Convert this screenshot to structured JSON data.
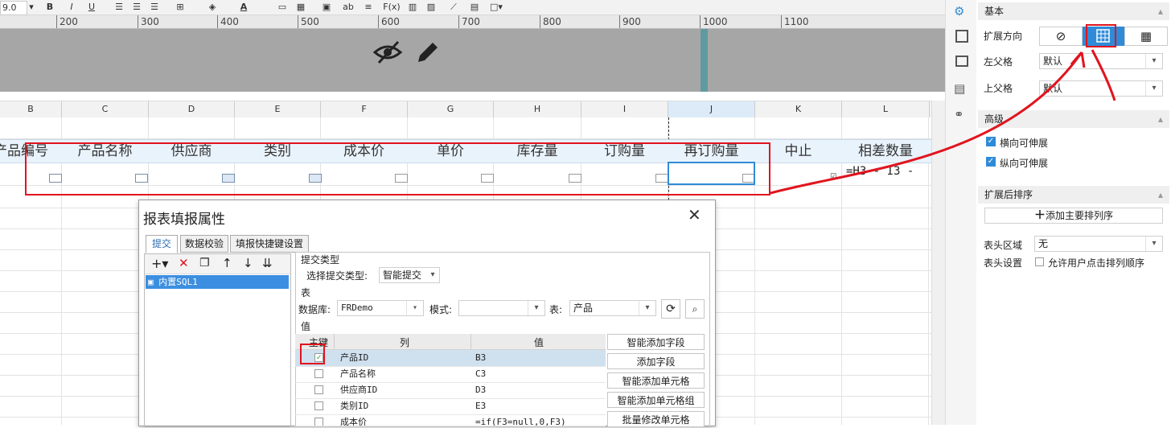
{
  "toolbar": {
    "font_size": "9.0",
    "bold": "B",
    "italic": "I",
    "underline": "U",
    "ab": "ab",
    "fx": "F(x)",
    "font_color": "A"
  },
  "ruler": {
    "ticks": [
      "200",
      "300",
      "400",
      "500",
      "600",
      "700",
      "800",
      "900",
      "1000",
      "1100"
    ]
  },
  "columns": [
    "B",
    "C",
    "D",
    "E",
    "F",
    "G",
    "H",
    "I",
    "J",
    "K",
    "L"
  ],
  "header_cells": [
    "产品编号",
    "产品名称",
    "供应商",
    "类别",
    "成本价",
    "单价",
    "库存量",
    "订购量",
    "再订购量",
    "中止",
    "相差数量"
  ],
  "formula_cell": "=H3 - I3 -",
  "panel": {
    "basic": "基本",
    "expand_direction": "扩展方向",
    "left_parent": "左父格",
    "left_parent_value": "默认",
    "top_parent": "上父格",
    "top_parent_value": "默认",
    "advanced": "高级",
    "horizontal_stretch": "横向可伸展",
    "vertical_stretch": "纵向可伸展",
    "sort_after_expand": "扩展后排序",
    "add_primary_sort": "添加主要排列序",
    "header_area": "表头区域",
    "header_area_value": "无",
    "header_settings": "表头设置",
    "allow_user_sort": "允许用户点击排列顺序"
  },
  "dialog": {
    "title": "报表填报属性",
    "tabs": [
      "提交",
      "数据校验",
      "填报快捷键设置"
    ],
    "list_item": "内置SQL1",
    "submit_type_group": "提交类型",
    "choose_submit_type": "选择提交类型:",
    "submit_type_value": "智能提交",
    "table_group": "表",
    "database_label": "数据库:",
    "database_value": "FRDemo",
    "schema_label": "模式:",
    "schema_value": "",
    "table_label": "表:",
    "table_value": "产品",
    "value_group": "值",
    "col_headers": [
      "主键",
      "列",
      "值"
    ],
    "rows": [
      {
        "key": true,
        "col": "产品ID",
        "val": "B3"
      },
      {
        "key": false,
        "col": "产品名称",
        "val": "C3"
      },
      {
        "key": false,
        "col": "供应商ID",
        "val": "D3"
      },
      {
        "key": false,
        "col": "类别ID",
        "val": "E3"
      },
      {
        "key": false,
        "col": "成本价",
        "val": "=if(F3=null,0,F3)"
      }
    ],
    "buttons": [
      "智能添加字段",
      "添加字段",
      "智能添加单元格",
      "智能添加单元格组",
      "批量修改单元格"
    ]
  },
  "colors": {
    "highlight_red": "#e0141e",
    "selection_blue": "#2f8bd8",
    "header_row_bg": "#e9f3fc"
  }
}
